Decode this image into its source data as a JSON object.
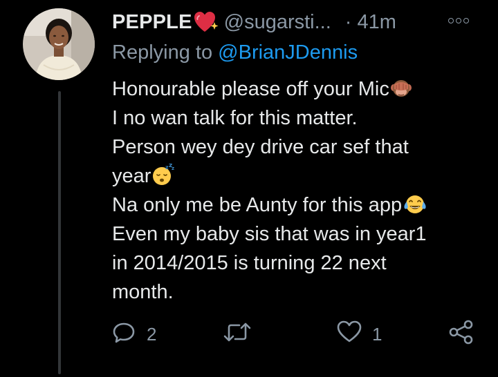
{
  "tweet": {
    "display_name": "PEPPLE",
    "handle": "@sugarsti...",
    "separator": "·",
    "time": "41m",
    "reply_prefix": "Replying to ",
    "reply_mention": "@BrianJDennis",
    "lines": [
      "Honourable please off your Mic",
      "I no wan talk for this matter.",
      "Person wey dey drive car sef that",
      "year",
      "Na only me be Aunty for this app",
      "Even my baby sis that was in year1",
      "in 2014/2015 is turning 22 next",
      "month."
    ],
    "emojis": {
      "name": "sparkling-heart-icon",
      "line1": "see-no-evil-monkey-icon",
      "line4": "sleeping-face-icon",
      "line5": "tears-of-joy-icon"
    }
  },
  "actions": {
    "reply_count": "2",
    "retweet_count": "",
    "like_count": "1"
  },
  "colors": {
    "background": "#000000",
    "text": "#e7e9ea",
    "muted": "#8b98a5",
    "link": "#1d9bf0",
    "thread_line": "#333639"
  }
}
